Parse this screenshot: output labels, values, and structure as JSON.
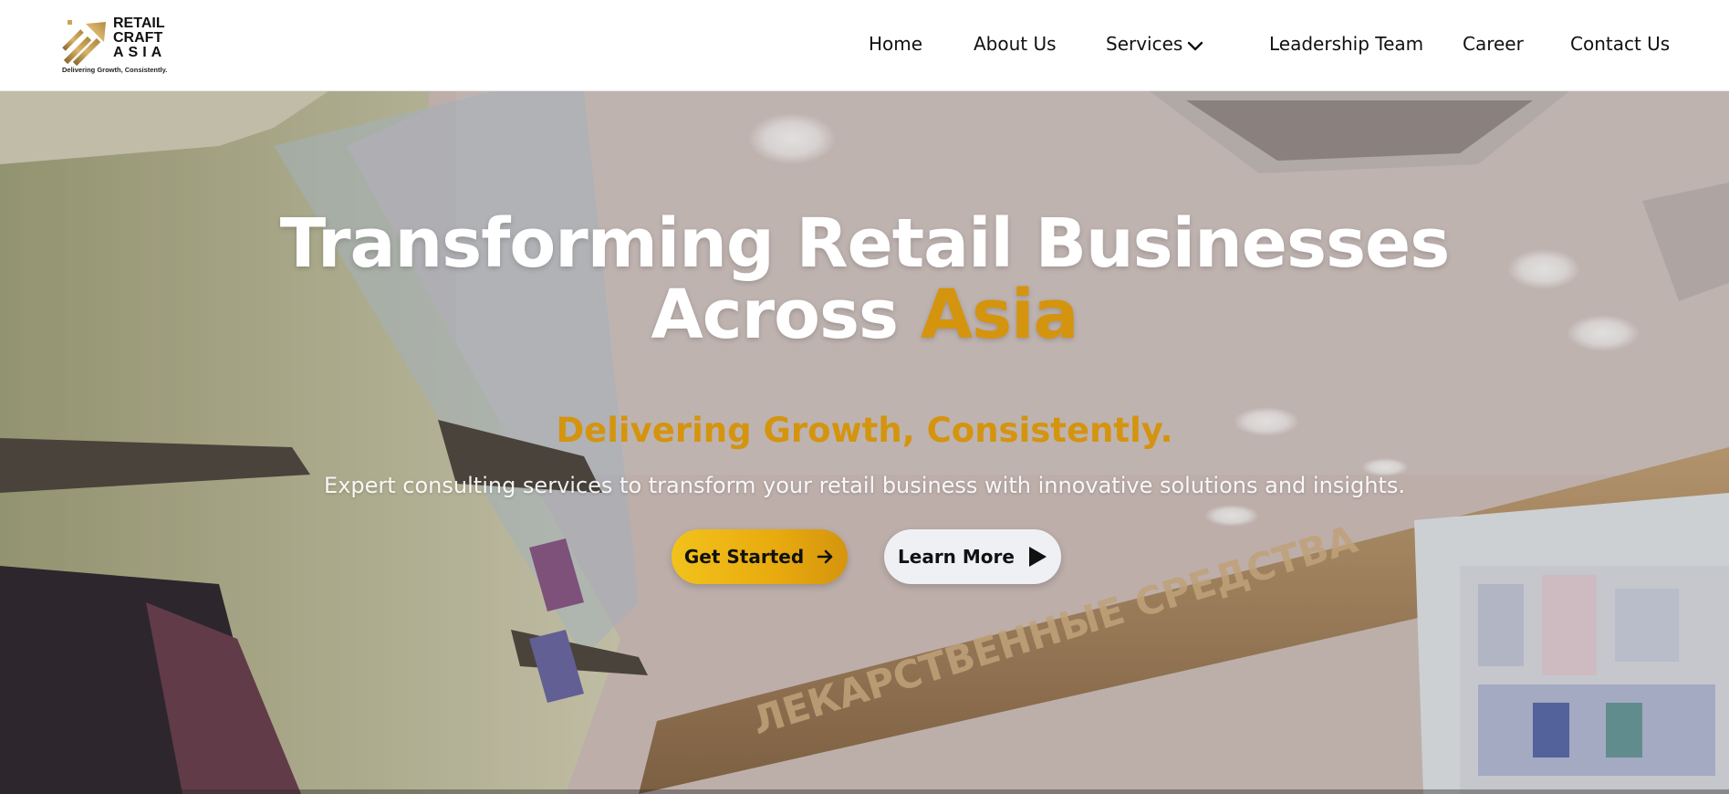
{
  "brand": {
    "logo_line1": "RETAIL",
    "logo_line2": "CRAFT",
    "logo_line3": "ASIA",
    "logo_tagline": "Delivering Growth, Consistently.",
    "accent_color": "#d4940e"
  },
  "nav": {
    "items": [
      {
        "label": "Home"
      },
      {
        "label": "About Us"
      },
      {
        "label": "Services",
        "icon": "chevron-down-icon"
      },
      {
        "label": "Leadership Team"
      },
      {
        "label": "Career"
      },
      {
        "label": "Contact Us"
      }
    ]
  },
  "hero": {
    "title_line1": "Transforming Retail Businesses",
    "title_line2_plain": "Across",
    "title_line2_accent": "Asia",
    "tagline": "Delivering Growth, Consistently.",
    "subtext": "Expert consulting services to transform your retail business with innovative solutions and insights.",
    "primary_button": {
      "label": "Get Started",
      "icon": "arrow-right-icon"
    },
    "secondary_button": {
      "label": "Learn More",
      "icon": "play-icon"
    },
    "sign_text": "ЛЕКАРСТВЕННЫЕ СРЕДСТВА"
  }
}
